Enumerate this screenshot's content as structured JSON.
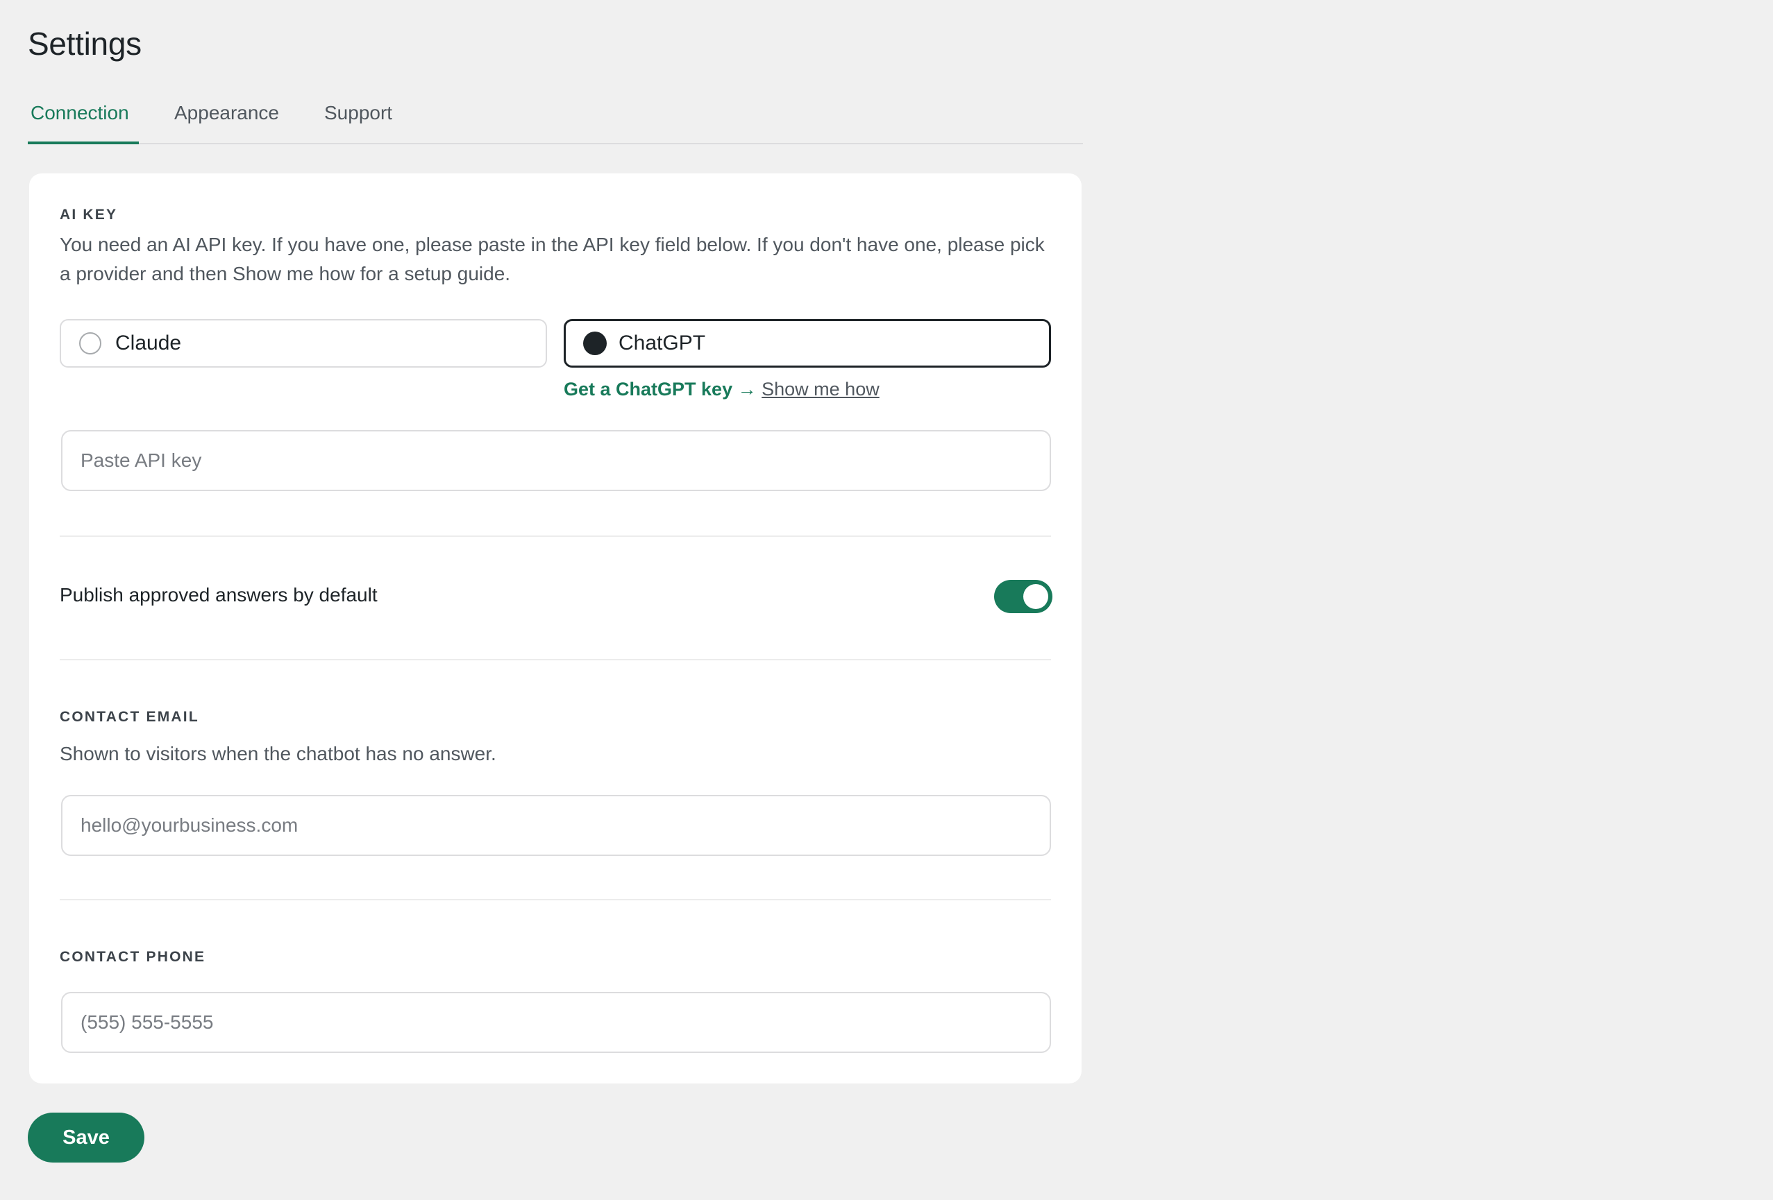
{
  "page": {
    "title": "Settings"
  },
  "tabs": [
    {
      "label": "Connection",
      "active": true
    },
    {
      "label": "Appearance",
      "active": false
    },
    {
      "label": "Support",
      "active": false
    }
  ],
  "ai_key": {
    "label": "AI KEY",
    "description": "You need an AI API key. If you have one, please paste in the API key field below. If you don't have one, please pick a provider and then Show me how for a setup guide.",
    "providers": [
      {
        "label": "Claude",
        "selected": false
      },
      {
        "label": "ChatGPT",
        "selected": true
      }
    ],
    "help_text": "Get a ChatGPT key",
    "help_arrow": "→",
    "help_link": "Show me how",
    "input_placeholder": "Paste API key",
    "input_value": ""
  },
  "publish": {
    "label": "Publish approved answers by default",
    "enabled": true
  },
  "contact_email": {
    "label": "CONTACT EMAIL",
    "description": "Shown to visitors when the chatbot has no answer.",
    "placeholder": "hello@yourbusiness.com",
    "value": ""
  },
  "contact_phone": {
    "label": "CONTACT PHONE",
    "placeholder": "(555) 555-5555",
    "value": ""
  },
  "actions": {
    "save_label": "Save"
  },
  "colors": {
    "accent": "#187a5a",
    "background": "#f0f0f0",
    "card": "#ffffff",
    "text": "#1d2327"
  }
}
